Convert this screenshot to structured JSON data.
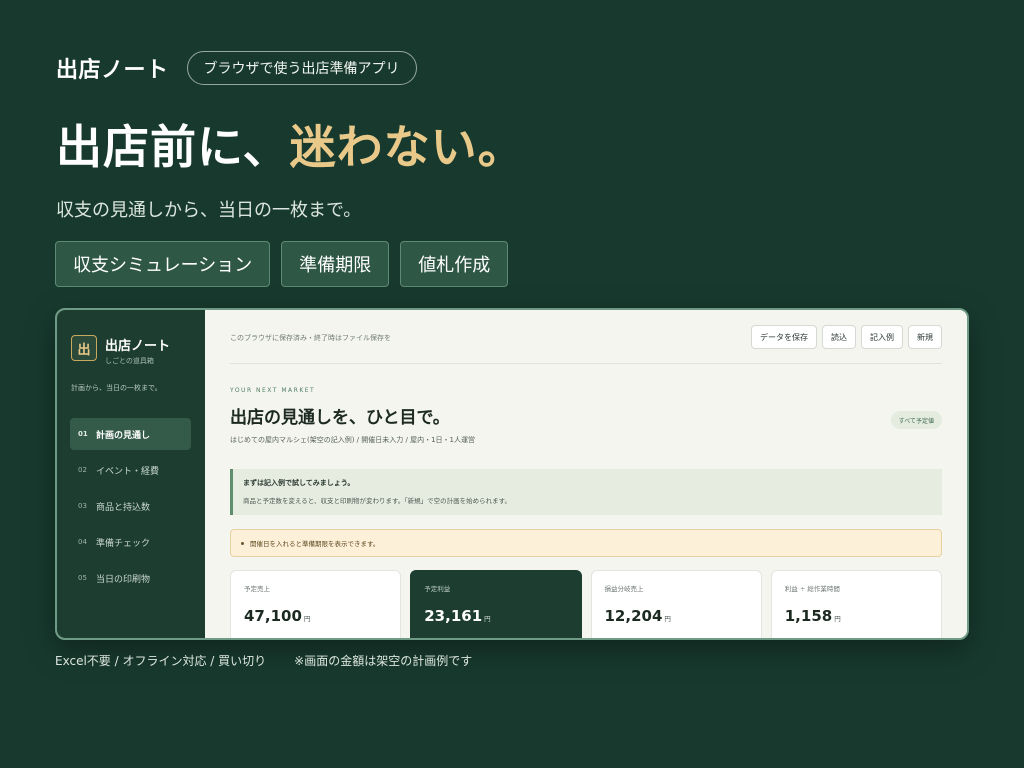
{
  "brand": {
    "name": "出店ノート",
    "badge": "ブラウザで使う出店準備アプリ"
  },
  "hero": {
    "headline_main": "出店前に、",
    "headline_accent": "迷わない。",
    "tagline": "収支の見通しから、当日の一枚まで。"
  },
  "feature_pills": [
    "収支シミュレーション",
    "準備期限",
    "値札作成"
  ],
  "app": {
    "sidebar": {
      "logo_char": "出",
      "title": "出店ノート",
      "subtitle": "しごとの道具箱",
      "description": "計画から、当日の一枚まで。",
      "nav": [
        {
          "num": "01",
          "label": "計画の見通し",
          "active": true
        },
        {
          "num": "02",
          "label": "イベント・経費",
          "active": false
        },
        {
          "num": "03",
          "label": "商品と持込数",
          "active": false
        },
        {
          "num": "04",
          "label": "準備チェック",
          "active": false
        },
        {
          "num": "05",
          "label": "当日の印刷物",
          "active": false
        }
      ]
    },
    "topbar": {
      "note": "このブラウザに保存済み・終了時はファイル保存を",
      "buttons": {
        "save": "データを保存",
        "load": "読込",
        "example": "記入例",
        "new": "新規"
      }
    },
    "header": {
      "eyebrow": "YOUR NEXT MARKET",
      "title": "出店の見通しを、ひと目で。",
      "subtitle": "はじめての屋内マルシェ(架空の記入例) / 開催日未入力 / 屋内・1日・1人運営",
      "status": "すべて予定値"
    },
    "hint": {
      "title": "まずは記入例で試してみましょう。",
      "body": "商品と予定数を変えると、収支と印刷物が変わります。「新規」で空の計画を始められます。"
    },
    "notice": "開催日を入れると準備期限を表示できます。",
    "kpis": [
      {
        "label": "予定売上",
        "value": "47,100",
        "unit": "円",
        "highlight": false
      },
      {
        "label": "予定利益",
        "value": "23,161",
        "unit": "円",
        "highlight": true
      },
      {
        "label": "損益分岐売上",
        "value": "12,204",
        "unit": "円",
        "highlight": false
      },
      {
        "label": "利益 ÷ 総作業時間",
        "value": "1,158",
        "unit": "円",
        "highlight": false
      }
    ]
  },
  "footer": {
    "left": "Excel不要 / オフライン対応 / 買い切り",
    "right": "※画面の金額は架空の計画例です"
  },
  "colors": {
    "background": "#183a2e",
    "accent_gold": "#e9c98a",
    "sidebar": "#1c3d30",
    "hint_bg": "#e6ece0",
    "notice_bg": "#fdf0d8"
  }
}
